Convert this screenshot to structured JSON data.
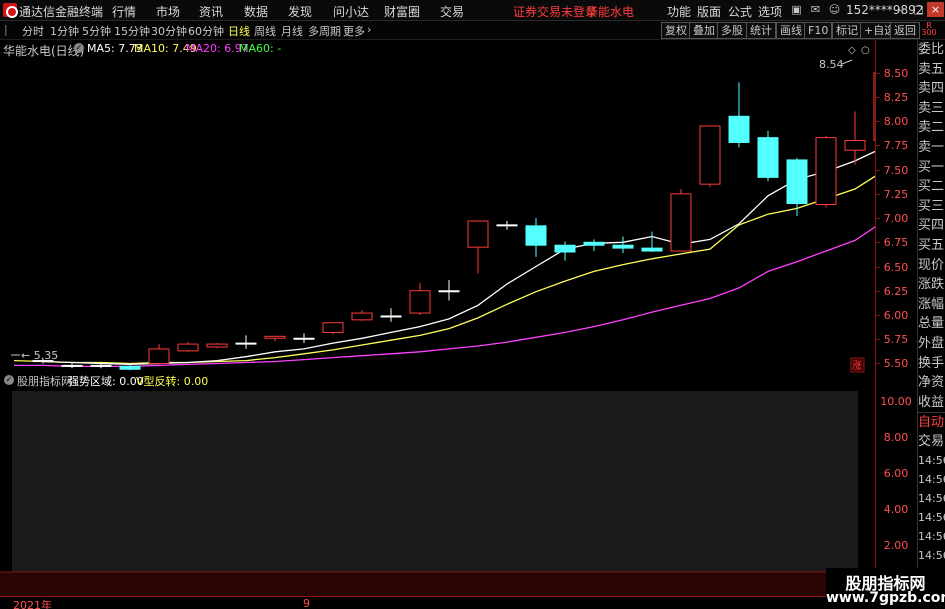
{
  "menubar": {
    "app_title": "通达信金融终端",
    "menus": [
      "行情",
      "市场",
      "资讯",
      "数据",
      "发现",
      "问小达",
      "财富圈",
      "交易"
    ],
    "status_text": "证券交易未登录",
    "stock_name": "华能水电",
    "tools": [
      "功能",
      "版面",
      "公式",
      "选项"
    ],
    "account": "152****9892"
  },
  "toolbar": {
    "periods": [
      "分时",
      "1分钟",
      "5分钟",
      "15分钟",
      "30分钟",
      "60分钟",
      "日线",
      "周线",
      "月线",
      "多周期",
      "更多"
    ],
    "active_period": "日线",
    "buttons": [
      "复权",
      "叠加",
      "多股",
      "统计",
      "画线",
      "F10",
      "标记",
      "+自选",
      "返回"
    ],
    "badge": [
      "R",
      "300"
    ]
  },
  "main_chart": {
    "title": "华能水电(日线)",
    "ma5": "MA5: 7.73",
    "ma10": "MA10: 7.49",
    "ma20": "MA20: 6.97",
    "ma60": "MA60: -",
    "max_label": "8.54",
    "min_label": "5.35",
    "zhang_tag": "涨"
  },
  "sub_chart": {
    "indicator": "股朋指标网",
    "strong_zone": "强势区域: 0.00",
    "v_reversal": "V型反转: 0.00"
  },
  "y_axis": {
    "price_ticks": [
      "8.50",
      "8.25",
      "8.00",
      "7.75",
      "7.50",
      "7.25",
      "7.00",
      "6.75",
      "6.50",
      "6.25",
      "6.00",
      "5.75",
      "5.50"
    ],
    "sub_ticks": [
      "10.00",
      "8.00",
      "6.00",
      "4.00",
      "2.00"
    ]
  },
  "bottom_axis": {
    "year_label": "2021年",
    "month_label": "9"
  },
  "right_panel": {
    "items": [
      "委比",
      "卖五",
      "卖四",
      "卖三",
      "卖二",
      "卖一",
      "买一",
      "买二",
      "买三",
      "买四",
      "买五",
      "现价",
      "涨跌",
      "涨幅",
      "总量",
      "外盘",
      "换手",
      "净资",
      "收益"
    ],
    "auto_label": "自动",
    "trade_label": "交易",
    "times": [
      "14:56",
      "14:56",
      "14:56",
      "14:56",
      "14:56",
      "14:56",
      "14:56",
      "14:56",
      "14:56"
    ]
  },
  "watermark": {
    "title": "股朋指标网",
    "url": "www.7gpzb.com"
  },
  "colors": {
    "up": "#ff3c3c",
    "down": "#54ffff",
    "doji": "#ffffff",
    "ma5": "#ffffff",
    "ma10": "#ffff55",
    "ma20": "#ff40ff",
    "ma60": "#40ff40",
    "sub_fill": "#1a1a1a",
    "axis_red": "#8b1515"
  },
  "chart_data": {
    "type": "candlestick",
    "ylim": [
      5.35,
      8.6
    ],
    "candles": [
      {
        "o": 5.52,
        "h": 5.55,
        "c": 5.53,
        "l": 5.5
      },
      {
        "o": 5.47,
        "h": 5.5,
        "c": 5.48,
        "l": 5.45
      },
      {
        "o": 5.47,
        "h": 5.5,
        "c": 5.48,
        "l": 5.45
      },
      {
        "o": 5.47,
        "h": 5.49,
        "c": 5.44,
        "l": 5.43
      },
      {
        "o": 5.5,
        "h": 5.7,
        "c": 5.65,
        "l": 5.49
      },
      {
        "o": 5.63,
        "h": 5.72,
        "c": 5.7,
        "l": 5.62
      },
      {
        "o": 5.67,
        "h": 5.71,
        "c": 5.7,
        "l": 5.66
      },
      {
        "o": 5.7,
        "h": 5.79,
        "c": 5.71,
        "l": 5.65
      },
      {
        "o": 5.76,
        "h": 5.78,
        "c": 5.78,
        "l": 5.73
      },
      {
        "o": 5.76,
        "h": 5.81,
        "c": 5.76,
        "l": 5.71
      },
      {
        "o": 5.82,
        "h": 5.92,
        "c": 5.92,
        "l": 5.8
      },
      {
        "o": 5.95,
        "h": 6.05,
        "c": 6.02,
        "l": 5.94
      },
      {
        "o": 5.99,
        "h": 6.07,
        "c": 5.99,
        "l": 5.93
      },
      {
        "o": 6.02,
        "h": 6.33,
        "c": 6.25,
        "l": 6.0
      },
      {
        "o": 6.25,
        "h": 6.36,
        "c": 6.25,
        "l": 6.15
      },
      {
        "o": 6.7,
        "h": 6.97,
        "c": 6.97,
        "l": 6.43
      },
      {
        "o": 6.93,
        "h": 6.97,
        "c": 6.93,
        "l": 6.88
      },
      {
        "o": 6.92,
        "h": 7.0,
        "c": 6.72,
        "l": 6.6
      },
      {
        "o": 6.72,
        "h": 6.76,
        "c": 6.65,
        "l": 6.56
      },
      {
        "o": 6.75,
        "h": 6.78,
        "c": 6.72,
        "l": 6.66
      },
      {
        "o": 6.72,
        "h": 6.81,
        "c": 6.69,
        "l": 6.64
      },
      {
        "o": 6.69,
        "h": 6.86,
        "c": 6.66,
        "l": 6.65
      },
      {
        "o": 6.66,
        "h": 7.3,
        "c": 7.25,
        "l": 6.66
      },
      {
        "o": 7.35,
        "h": 7.95,
        "c": 7.95,
        "l": 7.32
      },
      {
        "o": 8.05,
        "h": 8.4,
        "c": 7.78,
        "l": 7.73
      },
      {
        "o": 7.83,
        "h": 7.9,
        "c": 7.42,
        "l": 7.38
      },
      {
        "o": 7.6,
        "h": 7.62,
        "c": 7.15,
        "l": 7.02
      },
      {
        "o": 7.14,
        "h": 7.85,
        "c": 7.83,
        "l": 7.11
      },
      {
        "o": 7.7,
        "h": 8.1,
        "c": 7.8,
        "l": 7.55
      },
      {
        "o": 7.8,
        "h": 8.54,
        "c": 8.5,
        "l": 7.8
      }
    ],
    "ma5": [
      5.52,
      5.51,
      5.5,
      5.49,
      5.5,
      5.51,
      5.53,
      5.57,
      5.62,
      5.65,
      5.71,
      5.76,
      5.82,
      5.88,
      5.96,
      6.1,
      6.32,
      6.5,
      6.68,
      6.74,
      6.75,
      6.81,
      6.73,
      6.78,
      6.94,
      7.23,
      7.4,
      7.48,
      7.59,
      7.73
    ],
    "ma10": [
      5.53,
      5.52,
      5.51,
      5.51,
      5.5,
      5.51,
      5.51,
      5.52,
      5.53,
      5.56,
      5.6,
      5.64,
      5.69,
      5.74,
      5.79,
      5.86,
      5.97,
      6.11,
      6.24,
      6.35,
      6.45,
      6.52,
      6.58,
      6.63,
      6.68,
      6.93,
      7.04,
      7.1,
      7.2,
      7.3,
      7.49
    ],
    "ma20": [
      5.48,
      5.48,
      5.47,
      5.47,
      5.47,
      5.48,
      5.49,
      5.5,
      5.51,
      5.52,
      5.54,
      5.56,
      5.58,
      5.6,
      5.62,
      5.65,
      5.68,
      5.72,
      5.77,
      5.82,
      5.88,
      5.95,
      6.03,
      6.1,
      6.17,
      6.28,
      6.45,
      6.55,
      6.66,
      6.77,
      6.97
    ]
  }
}
